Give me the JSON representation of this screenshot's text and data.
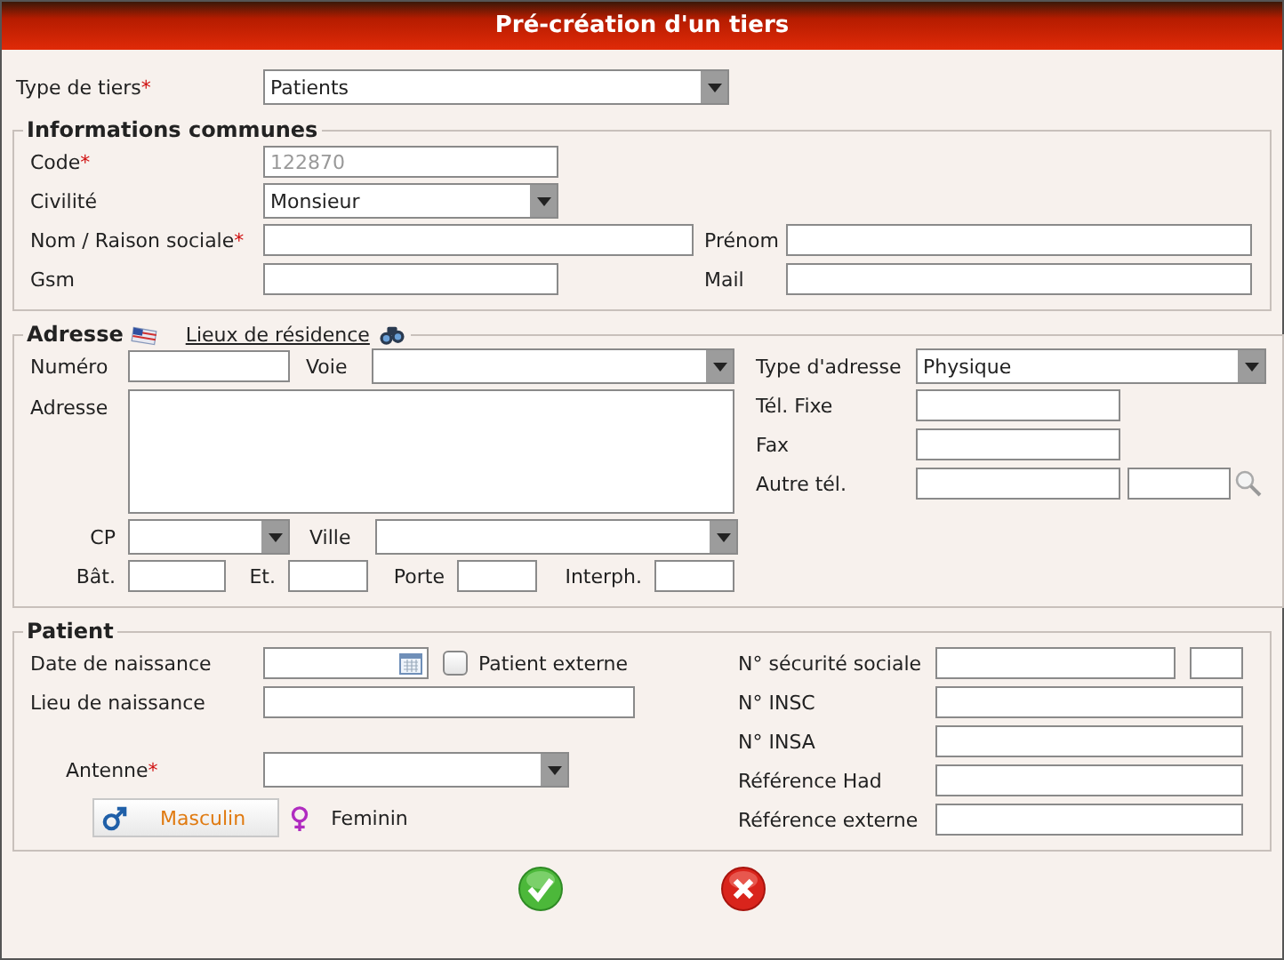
{
  "dialog": {
    "title": "Pré-création d'un tiers"
  },
  "type_de_tiers": {
    "label": "Type de tiers",
    "required_mark": "*",
    "value": "Patients"
  },
  "informations_communes": {
    "legend": "Informations communes",
    "code": {
      "label": "Code",
      "required_mark": "*",
      "value": "122870",
      "disabled": true
    },
    "civilite": {
      "label": "Civilité",
      "value": "Monsieur"
    },
    "nom": {
      "label": "Nom / Raison sociale",
      "required_mark": "*"
    },
    "prenom": {
      "label": "Prénom"
    },
    "gsm": {
      "label": "Gsm"
    },
    "mail": {
      "label": "Mail"
    }
  },
  "adresse": {
    "legend": "Adresse",
    "link": "Lieux de résidence",
    "numero": {
      "label": "Numéro"
    },
    "voie": {
      "label": "Voie"
    },
    "adresse": {
      "label": "Adresse"
    },
    "cp": {
      "label": "CP"
    },
    "ville": {
      "label": "Ville"
    },
    "bat": {
      "label": "Bât."
    },
    "et": {
      "label": "Et."
    },
    "porte": {
      "label": "Porte"
    },
    "interph": {
      "label": "Interph."
    },
    "type_adresse": {
      "label": "Type d'adresse",
      "value": "Physique"
    },
    "tel_fixe": {
      "label": "Tél. Fixe"
    },
    "fax": {
      "label": "Fax"
    },
    "autre_tel": {
      "label": "Autre tél."
    }
  },
  "patient": {
    "legend": "Patient",
    "date_naissance": {
      "label": "Date de naissance"
    },
    "patient_externe": {
      "label": "Patient externe",
      "checked": false
    },
    "lieu_naissance": {
      "label": "Lieu de naissance"
    },
    "antenne": {
      "label": "Antenne",
      "required_mark": "*"
    },
    "sexe": [
      {
        "kind": "male",
        "label": "Masculin",
        "selected": true
      },
      {
        "kind": "female",
        "label": "Feminin",
        "selected": false
      }
    ],
    "securite_sociale": {
      "label": "N° sécurité sociale"
    },
    "insc": {
      "label": "N° INSC"
    },
    "insa": {
      "label": "N° INSA"
    },
    "ref_had": {
      "label": "Référence Had"
    },
    "ref_externe": {
      "label": "Référence externe"
    }
  }
}
